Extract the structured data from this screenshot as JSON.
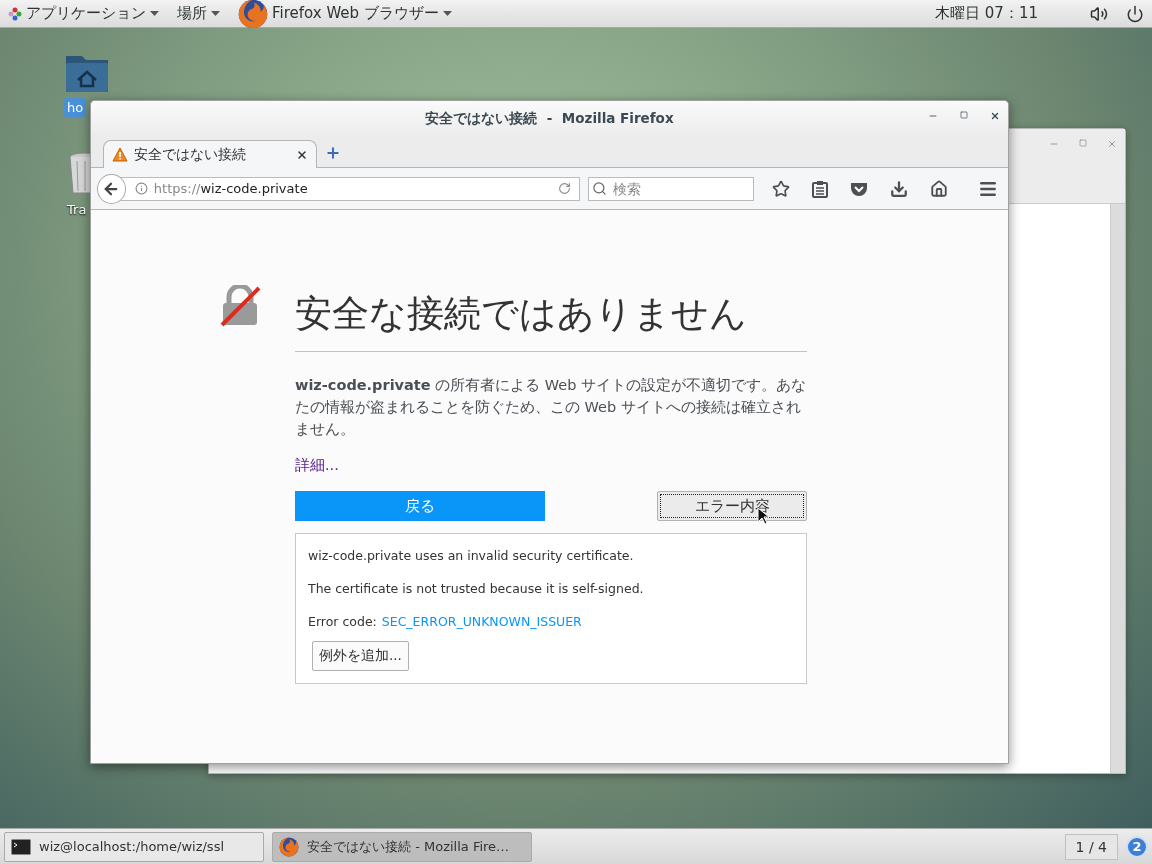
{
  "top_bar": {
    "menus": [
      {
        "label": "アプリケーション"
      },
      {
        "label": "場所"
      },
      {
        "label": "Firefox Web ブラウザー"
      }
    ],
    "clock": "木曜日 07：11"
  },
  "desktop_icons": [
    {
      "kind": "folder",
      "label": "ho",
      "selected": true
    },
    {
      "kind": "trash",
      "label": "Tra",
      "selected": false
    }
  ],
  "browser": {
    "title": "安全ではない接続  -  Mozilla Firefox",
    "tabs": [
      {
        "label": "安全ではない接続",
        "selected": true
      }
    ],
    "url_scheme": "https://",
    "url_host": "wiz-code.private",
    "search": {
      "placeholder": "検索"
    },
    "page": {
      "heading": "安全な接続ではありません",
      "description": "**wiz-code.private** の所有者による Web サイトの設定が不適切です。あなたの情報が盗まれることを防ぐため、この Web サイトへの接続は確立されません。",
      "details_link": "詳細...",
      "back_button": "戻る",
      "error_button": {
        "label": "エラー内容",
        "focused": true
      },
      "details": {
        "lines": [
          "wiz-code.private uses an invalid security certificate.",
          "The certificate is not trusted because it is self-signed."
        ],
        "error_label": "Error code:",
        "error_code": "SEC_ERROR_UNKNOWN_ISSUER",
        "exception_button": "例外を追加..."
      }
    }
  },
  "taskbar": {
    "windows": [
      {
        "kind": "terminal",
        "label": "wiz@localhost:/home/wiz/ssl",
        "selected": false
      },
      {
        "kind": "firefox",
        "label": "安全ではない接続  -  Mozilla Fire…",
        "selected": true
      }
    ],
    "workspace": "1 / 4",
    "badge": "2"
  }
}
